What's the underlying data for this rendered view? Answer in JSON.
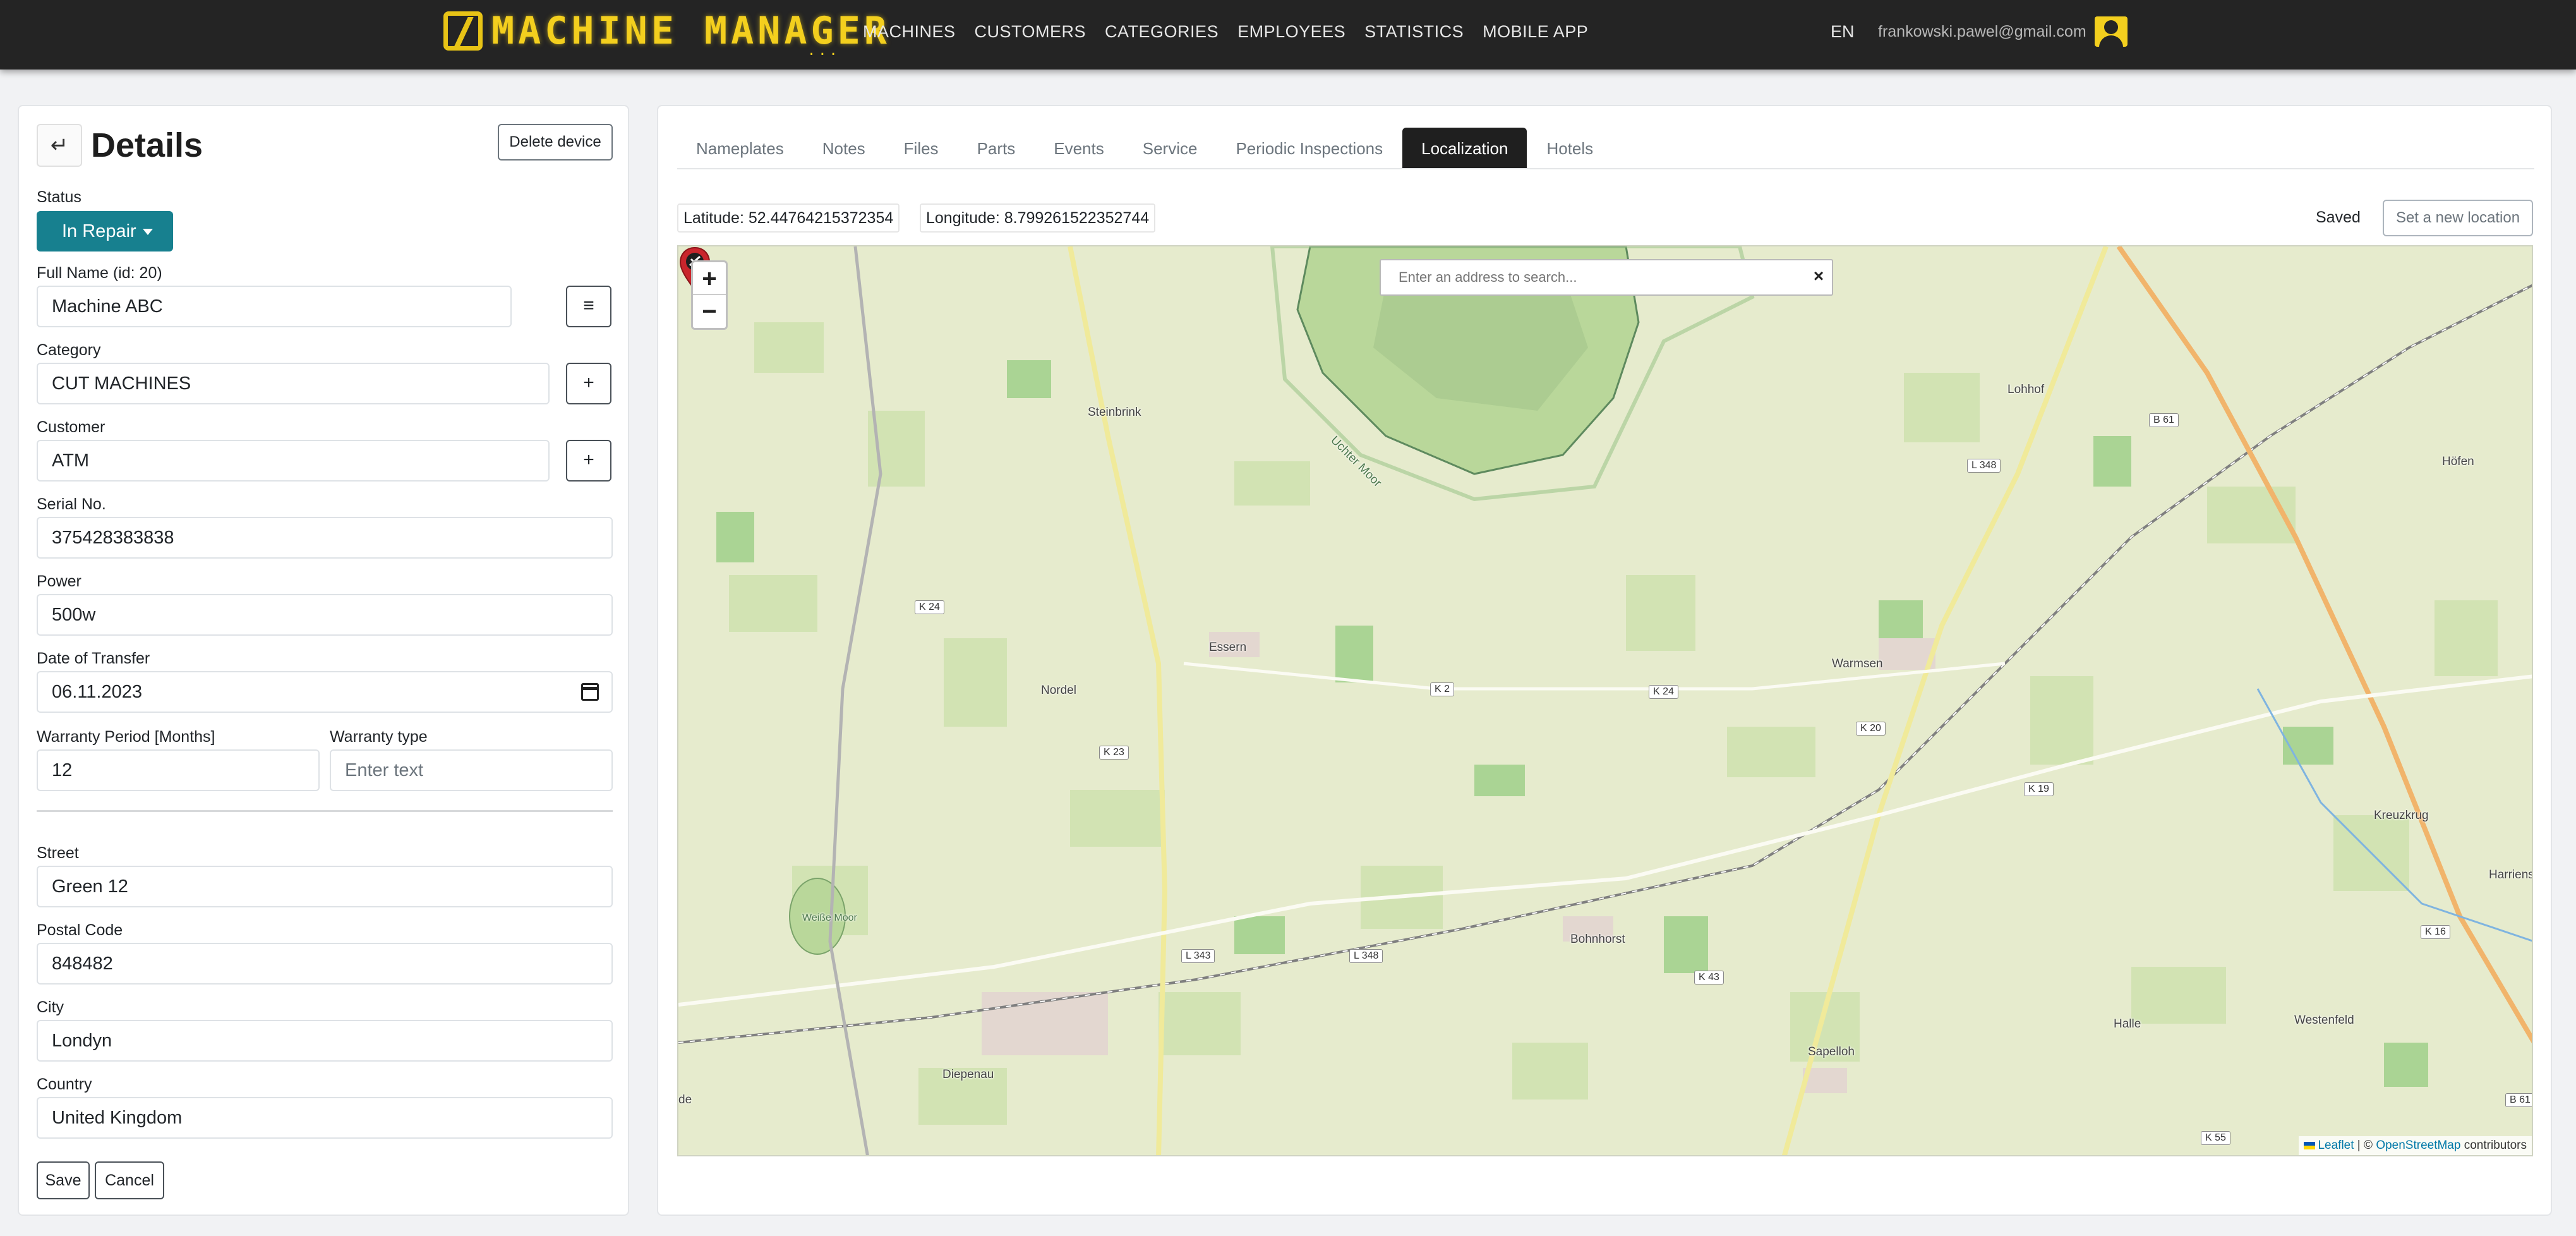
{
  "navbar": {
    "brand": "MACHINE MANAGER",
    "brand_dots": "...",
    "links": [
      "MACHINES",
      "CUSTOMERS",
      "CATEGORIES",
      "EMPLOYEES",
      "STATISTICS",
      "MOBILE APP"
    ],
    "lang": "EN",
    "email": "frankowski.pawel@gmail.com"
  },
  "details": {
    "back_symbol": "↵",
    "title": "Details",
    "delete_label": "Delete device",
    "status_label": "Status",
    "status_value": "In Repair",
    "full_name_label": "Full Name (id: 20)",
    "full_name_value": "Machine ABC",
    "full_name_btn": "≡",
    "category_label": "Category",
    "category_value": "CUT MACHINES",
    "category_btn": "+",
    "customer_label": "Customer",
    "customer_value": "ATM",
    "customer_btn": "+",
    "serial_label": "Serial No.",
    "serial_value": "375428383838",
    "power_label": "Power",
    "power_value": "500w",
    "transfer_label": "Date of Transfer",
    "transfer_value": "06.11.2023",
    "warranty_period_label": "Warranty Period [Months]",
    "warranty_period_value": "12",
    "warranty_type_label": "Warranty type",
    "warranty_type_placeholder": "Enter text",
    "street_label": "Street",
    "street_value": "Green 12",
    "postal_label": "Postal Code",
    "postal_value": "848482",
    "city_label": "City",
    "city_value": "Londyn",
    "country_label": "Country",
    "country_value": "United Kingdom",
    "save_label": "Save",
    "cancel_label": "Cancel"
  },
  "tabs": [
    "Nameplates",
    "Notes",
    "Files",
    "Parts",
    "Events",
    "Service",
    "Periodic Inspections",
    "Localization",
    "Hotels"
  ],
  "active_tab": "Localization",
  "location": {
    "latitude_text": "Latitude: 52.44764215372354",
    "longitude_text": "Longitude: 8.799261522352744",
    "saved_text": "Saved",
    "new_location_label": "Set a new location"
  },
  "map": {
    "zoom_in": "+",
    "zoom_out": "−",
    "search_placeholder": "Enter an address to search...",
    "search_clear": "×",
    "attribution_leaflet": "Leaflet",
    "attribution_sep": " | © ",
    "attribution_osm": "OpenStreetMap",
    "attribution_contrib": " contributors",
    "places": {
      "steinbrink": "Steinbrink",
      "essern": "Essern",
      "nordel": "Nordel",
      "warmsen": "Warmsen",
      "lohhof": "Lohhof",
      "hofen": "Höfen",
      "bohnhorst": "Bohnhorst",
      "diepenau": "Diepenau",
      "sapelloh": "Sapelloh",
      "halle": "Halle",
      "westenfeld": "Westenfeld",
      "kreuzkrug": "Kreuzkrug",
      "harriens": "Harriens",
      "uchter_moor": "Uchter Moor",
      "weisse_moor": "Weiße Moor",
      "de": "de"
    },
    "roads": {
      "k24a": "K 24",
      "k24b": "K 24",
      "k2": "K 2",
      "k23": "K 23",
      "k20": "K 20",
      "k19": "K 19",
      "k16": "K 16",
      "k43": "K 43",
      "k55": "K 55",
      "l343": "L 343",
      "l348a": "L 348",
      "l348b": "L 348",
      "b61a": "B 61",
      "b61b": "B 61"
    }
  },
  "colors": {
    "navbar_bg": "#242424",
    "brand_yellow": "#f3cf1e",
    "status_teal": "#17808f",
    "tab_active_bg": "#1f1f1f",
    "marker_red": "#c9252c"
  }
}
